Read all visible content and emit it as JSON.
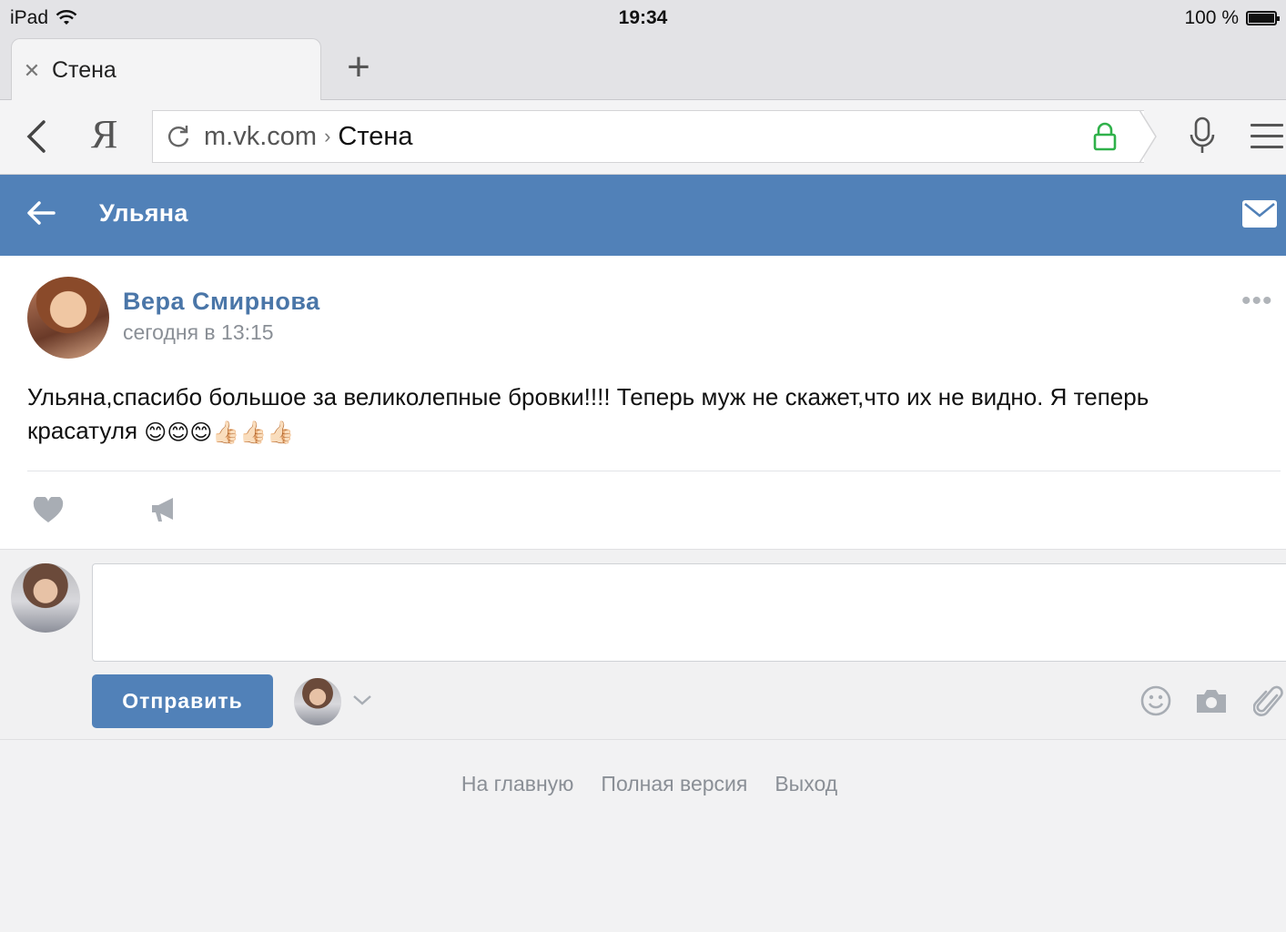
{
  "status_bar": {
    "device": "iPad",
    "time": "19:34",
    "battery": "100 %"
  },
  "browser": {
    "tab_title": "Стена",
    "new_tab_label": "+",
    "yandex_label": "Я",
    "url_domain": "m.vk.com",
    "url_separator": "›",
    "url_page": "Стена"
  },
  "vk_header": {
    "title": "Ульяна"
  },
  "post": {
    "author": "Вера Смирнова",
    "date": "сегодня в 13:15",
    "more": "•••",
    "text": "Ульяна,спасибо большое за великолепные бровки!!!! Теперь муж не скажет,что их не видно. Я теперь красатуля",
    "emojis": [
      "😊",
      "😊",
      "😊",
      "👍🏻",
      "👍🏻",
      "👍🏻"
    ]
  },
  "comment": {
    "placeholder": "",
    "send_label": "Отправить"
  },
  "footer": {
    "home": "На главную",
    "full_version": "Полная версия",
    "logout": "Выход"
  },
  "colors": {
    "vk_blue": "#5181b8",
    "link_blue": "#4a76a8",
    "lock_green": "#2fb14a"
  }
}
